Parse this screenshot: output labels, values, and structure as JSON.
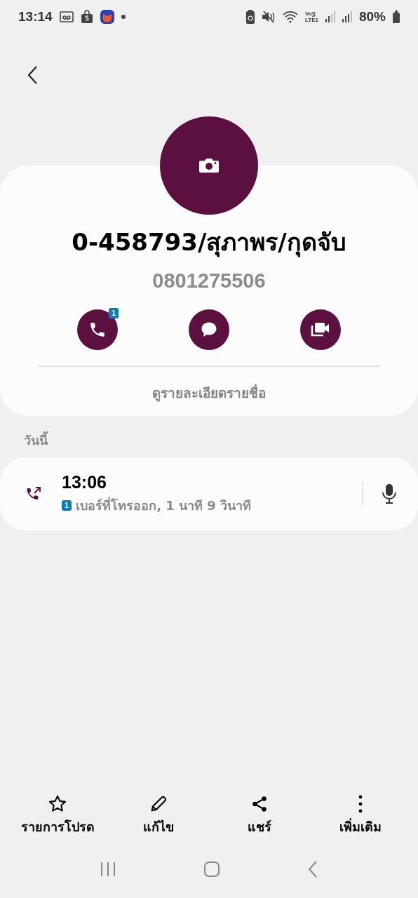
{
  "status_bar": {
    "time": "13:14",
    "volte": "Vo))",
    "network": "LTE1",
    "battery": "80%"
  },
  "contact": {
    "name": "0-458793/สุภาพร/กุดจับ",
    "number": "0801275506"
  },
  "actions": [
    {
      "kind": "call",
      "badge": "1"
    },
    {
      "kind": "message"
    },
    {
      "kind": "video"
    }
  ],
  "details_link": "ดูรายละเอียดรายชื่อ",
  "history": {
    "heading": "วันนี้",
    "calls": [
      {
        "kind": "outgoing",
        "time": "13:06",
        "sim": "1",
        "description": "เบอร์ที่โทรออก, 1 นาที 9 วินาที"
      }
    ]
  },
  "bottom_actions": [
    {
      "kind": "favorite",
      "label": "รายการโปรด"
    },
    {
      "kind": "edit",
      "label": "แก้ไข"
    },
    {
      "kind": "share",
      "label": "แชร์"
    },
    {
      "kind": "more",
      "label": "เพิ่มเติม"
    }
  ]
}
